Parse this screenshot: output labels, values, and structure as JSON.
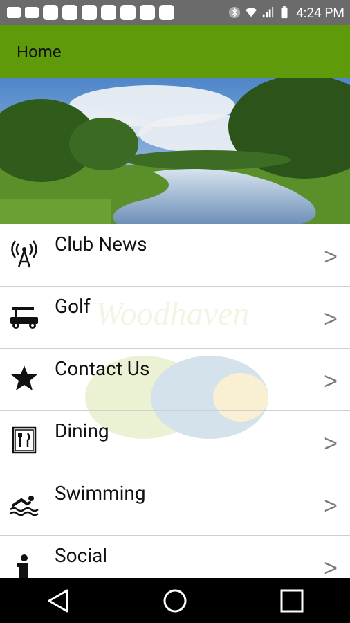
{
  "status_bar": {
    "time": "4:24 PM",
    "icons": [
      "notification-icon",
      "notification-icon",
      "app-icon",
      "app-icon",
      "app-icon",
      "app-icon",
      "app-icon",
      "app-icon",
      "app-icon",
      "bluetooth-icon",
      "wifi-icon",
      "signal-icon",
      "battery-icon"
    ]
  },
  "app_bar": {
    "title": "Home",
    "color": "#5f9a0a"
  },
  "menu": {
    "items": [
      {
        "label": "Club News",
        "icon": "broadcast-icon",
        "chevron": ">"
      },
      {
        "label": "Golf",
        "icon": "golf-cart-icon",
        "chevron": ">"
      },
      {
        "label": "Contact Us",
        "icon": "star-icon",
        "chevron": ">"
      },
      {
        "label": "Dining",
        "icon": "dining-icon",
        "chevron": ">"
      },
      {
        "label": "Swimming",
        "icon": "swimmer-icon",
        "chevron": ">"
      },
      {
        "label": "Social",
        "icon": "info-icon",
        "chevron": ">"
      }
    ],
    "watermark_text": "Woodhaven"
  },
  "nav_bar": {
    "buttons": [
      "back-icon",
      "home-icon",
      "recents-icon"
    ]
  }
}
